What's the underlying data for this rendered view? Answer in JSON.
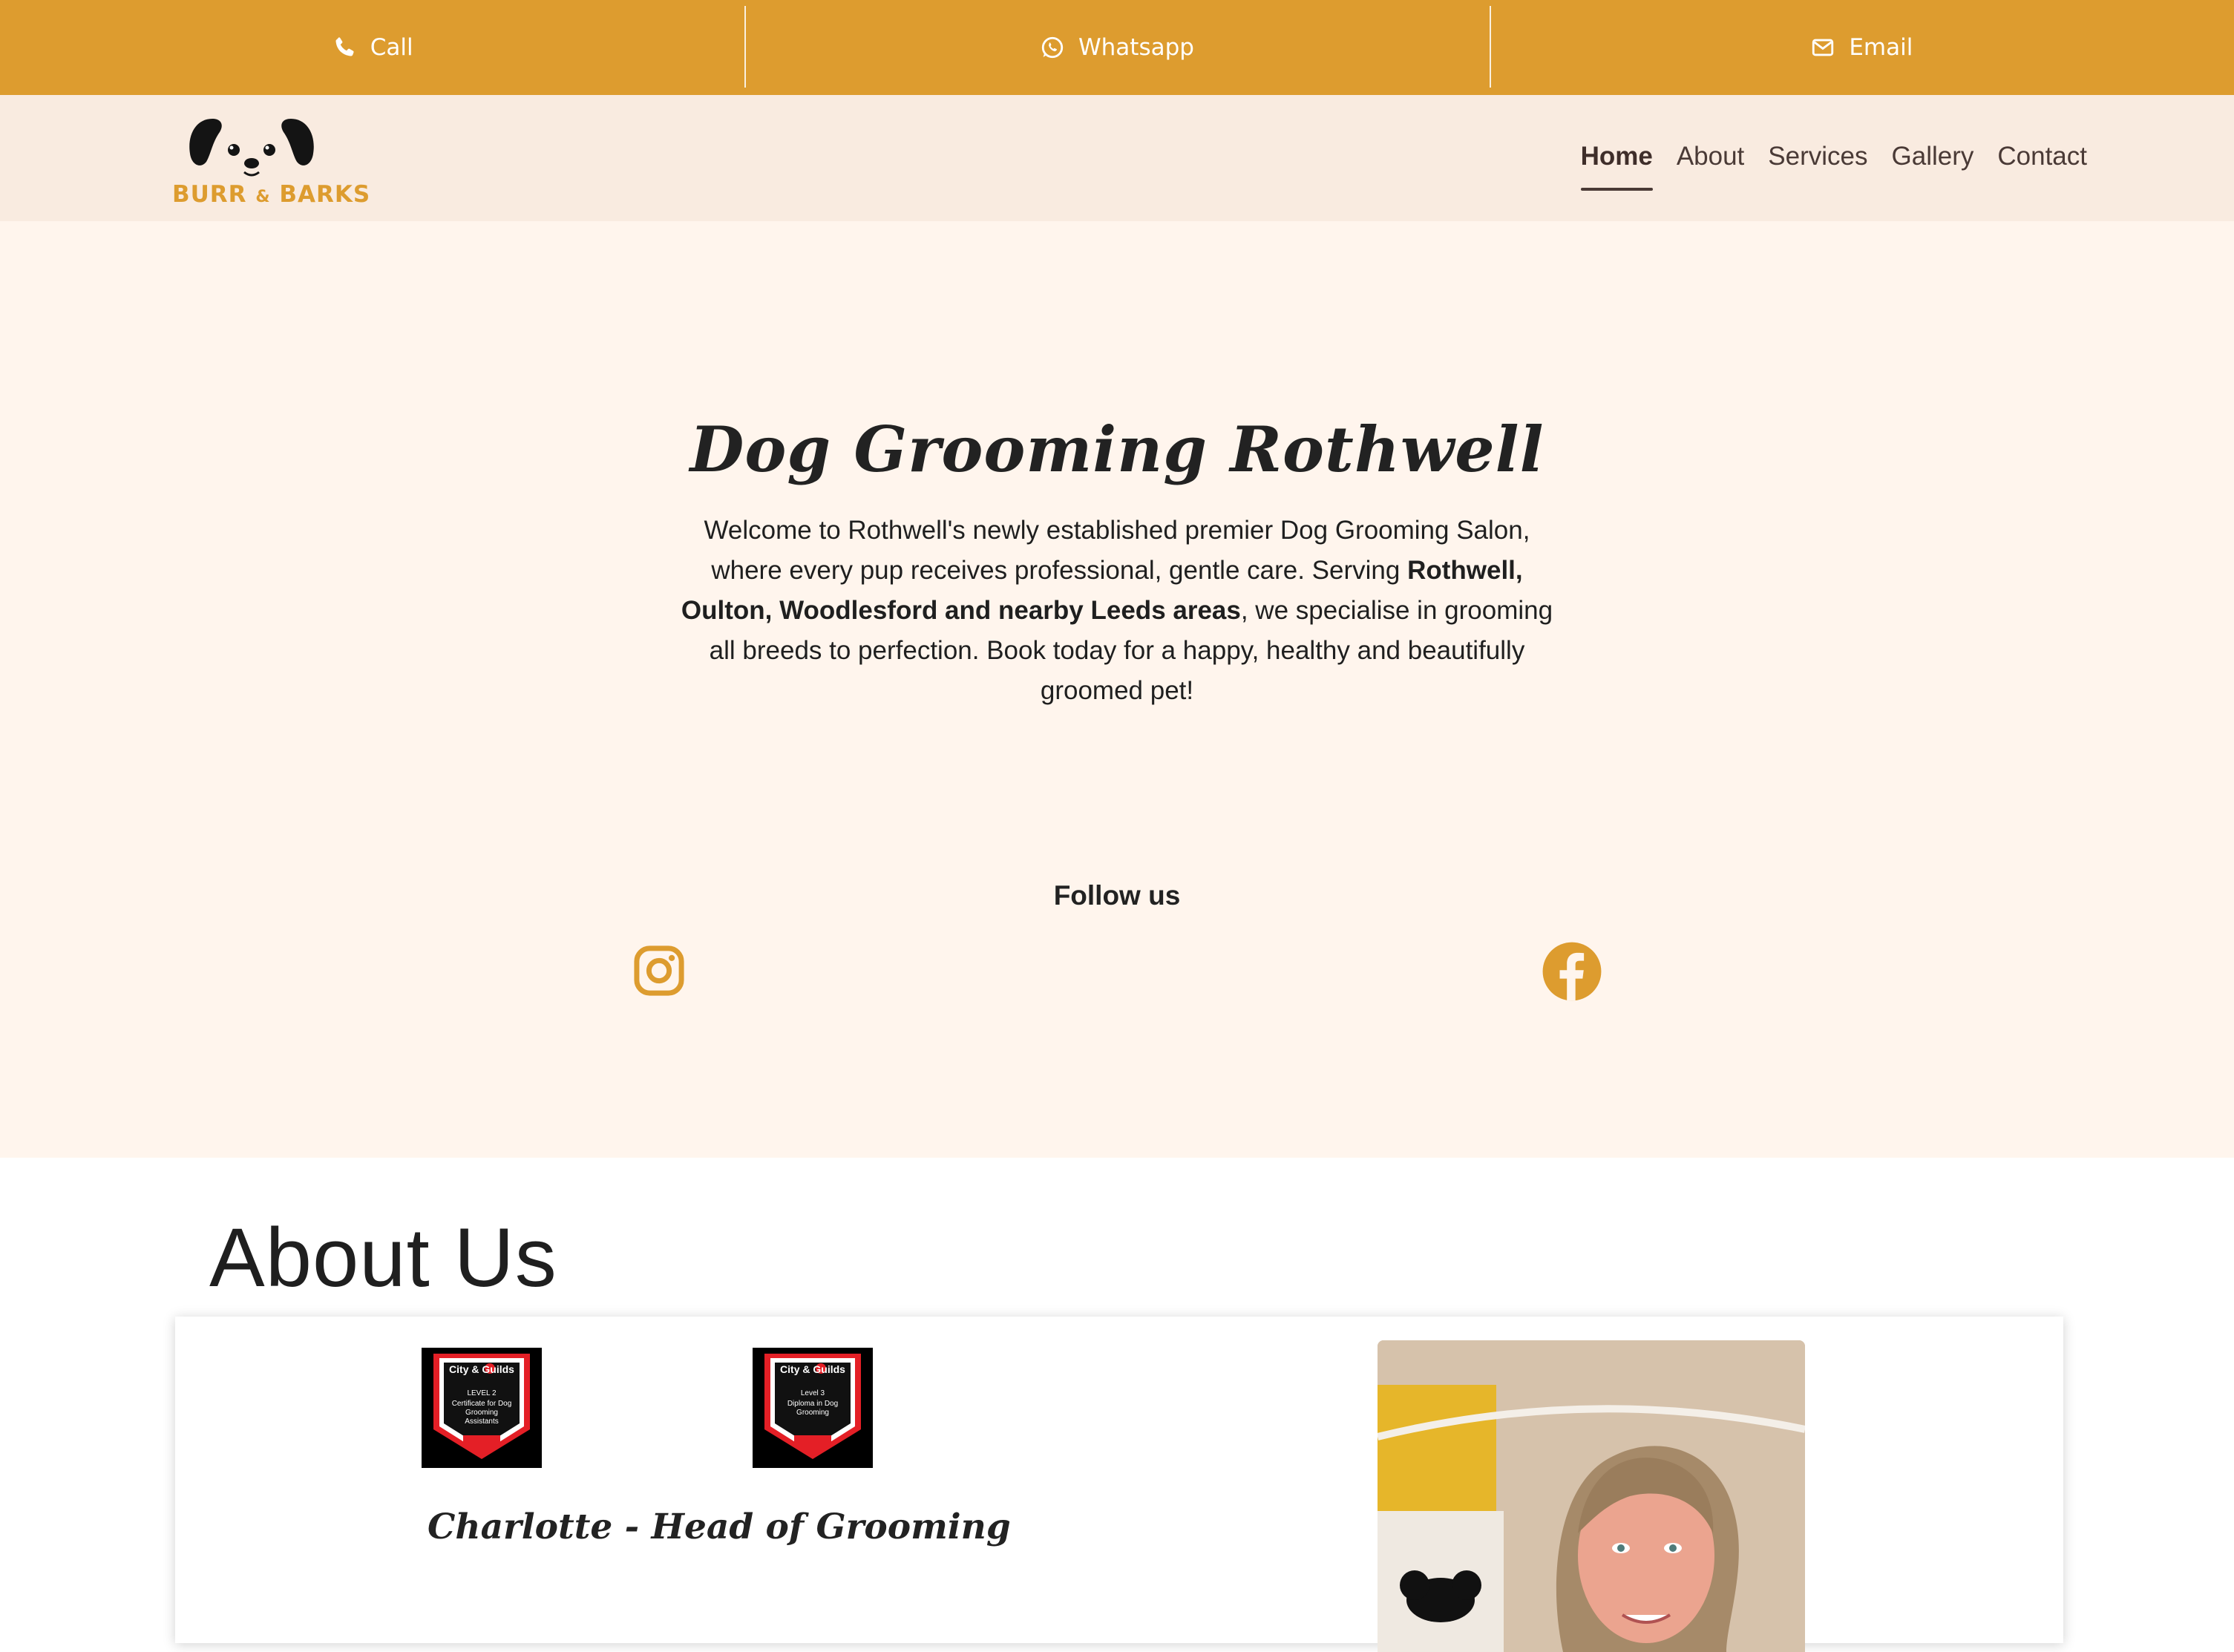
{
  "topbar": {
    "items": [
      {
        "label": "Call",
        "icon": "phone-icon"
      },
      {
        "label": "Whatsapp",
        "icon": "whatsapp-icon"
      },
      {
        "label": "Email",
        "icon": "envelope-icon"
      }
    ]
  },
  "brand": {
    "name": "BURR & BARKS",
    "name_part1": "BURR",
    "name_amp": "&",
    "name_part2": "BARKS",
    "logo_icon": "dog-face-icon"
  },
  "nav": {
    "items": [
      {
        "label": "Home",
        "active": true
      },
      {
        "label": "About",
        "active": false
      },
      {
        "label": "Services",
        "active": false
      },
      {
        "label": "Gallery",
        "active": false
      },
      {
        "label": "Contact",
        "active": false
      }
    ]
  },
  "hero": {
    "title": "Dog Grooming Rothwell",
    "text_part1": "Welcome to Rothwell's newly established premier Dog Grooming Salon, where every pup receives professional, gentle care. Serving ",
    "text_bold": "Rothwell, Oulton, Woodlesford and nearby Leeds areas",
    "text_part2": ", we specialise in grooming all breeds to perfection. Book today for a happy, healthy and beautifully groomed pet!",
    "follow_title": "Follow us",
    "social": [
      {
        "name": "instagram-icon"
      },
      {
        "name": "facebook-icon"
      }
    ]
  },
  "about": {
    "heading": "About Us",
    "badges": [
      {
        "brand": "City & Guilds",
        "level": "LEVEL 2",
        "desc": "Certificate for Dog Grooming Assistants"
      },
      {
        "brand": "City & Guilds",
        "level": "Level 3",
        "desc": "Diploma in Dog Grooming"
      }
    ],
    "staff_title": "Charlotte - Head of Grooming"
  },
  "colors": {
    "accent": "#dd9c2f",
    "nav_bg": "#f9ebe0",
    "hero_bg": "#fff5ed",
    "nav_text": "#4a3a36"
  }
}
